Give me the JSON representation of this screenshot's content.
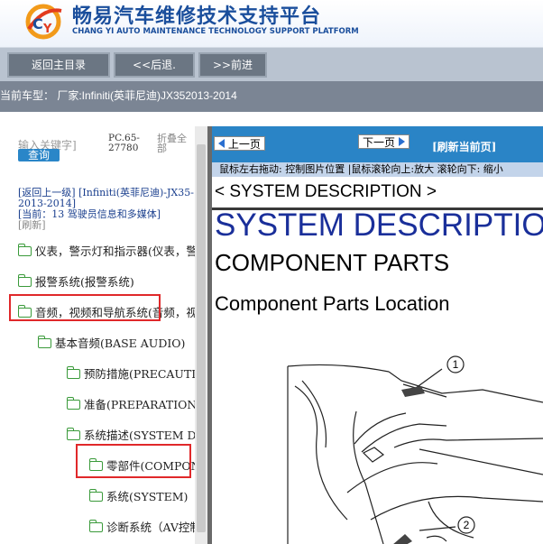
{
  "header": {
    "title_cn": "畅易汽车维修技术支持平台",
    "title_en": "CHANG YI AUTO MAINTENANCE TECHNOLOGY SUPPORT PLATFORM",
    "logo_icon": "cy-logo-icon"
  },
  "nav": {
    "home": "返回主目录",
    "back": "<<后退.",
    "forward": ">>前进"
  },
  "car": {
    "text": "当前车型： 厂家:Infiniti(英菲尼迪)JX352013-2014"
  },
  "left": {
    "search_placeholder": "输入关键字]",
    "search_button": "查询",
    "pc_code": "PC.65-27780",
    "collapse": "折叠全部",
    "back_link": "[返回上一级]",
    "breadcrumb": "[Infiniti(英菲尼迪)-JX35-2013-2014]",
    "current": "[当前：13 驾驶员信息和多媒体]",
    "refresh": "[刷新]",
    "tree": [
      {
        "label": "仪表，警示灯和指示器(仪表，警"
      },
      {
        "label": "报警系统(报警系统)"
      },
      {
        "label": "音频，视频和导航系统(音频，视"
      },
      {
        "label": "基本音频(BASE AUDIO)"
      },
      {
        "label": "预防措施(PRECAUTION)"
      },
      {
        "label": "准备(PREPARATION)"
      },
      {
        "label": "系统描述(SYSTEM DESCRIPTION)"
      },
      {
        "label": "零部件(COMPONENT PARTS)"
      },
      {
        "label": "系统(SYSTEM)"
      },
      {
        "label": "诊断系统（AV控制单元）"
      }
    ]
  },
  "right": {
    "prev": "上一页",
    "next": "下一页",
    "refresh": "[刷新当前页]",
    "hint": "鼠标左右拖动: 控制图片位置 |鼠标滚轮向上:放大  滚轮向下: 缩小",
    "doc": {
      "section": "< SYSTEM DESCRIPTION >",
      "heading": "SYSTEM DESCRIPTION",
      "subheading": "COMPONENT PARTS",
      "subsub": "Component Parts Location",
      "callout_1": "1",
      "callout_2": "2"
    }
  },
  "colors": {
    "brand_blue": "#1a4e9c",
    "page_bar": "#2a84c6",
    "highlight_red": "#e0282a"
  }
}
